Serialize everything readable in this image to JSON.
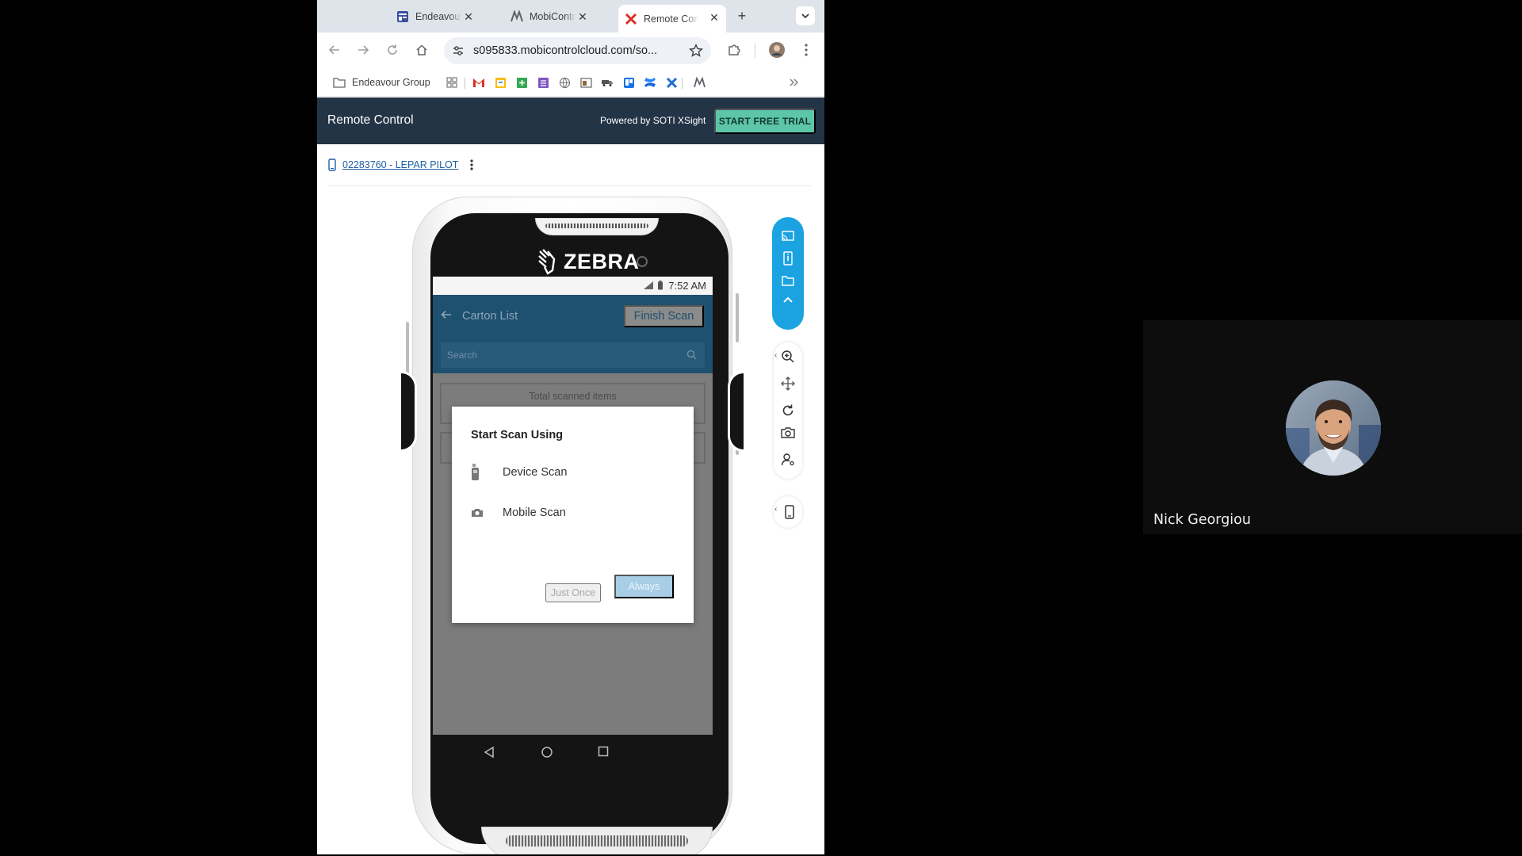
{
  "browser": {
    "tabs": [
      {
        "title": "Endeavour Gr",
        "favicon": "forms-icon",
        "color": "#3c4e9f"
      },
      {
        "title": "MobiControl",
        "favicon": "mobicontrol-icon",
        "color": "#5f6368"
      },
      {
        "title": "Remote Contr",
        "favicon": "soti-x-icon",
        "color": "#d93025"
      }
    ],
    "address": "s095833.mobicontrolcloud.com/so...",
    "bookmark_folder": "Endeavour Group"
  },
  "page": {
    "header_title": "Remote Control",
    "powered_by": "Powered by SOTI XSight",
    "trial_button": "START FREE TRIAL",
    "device_link": "02283760 - LEPAR PILOT"
  },
  "device": {
    "brand": "ZEBRA",
    "status_time": "7:52 AM",
    "app": {
      "title": "Carton List",
      "finish_button": "Finish Scan",
      "search_placeholder": "Search",
      "total_label": "Total scanned items"
    },
    "dialog": {
      "title": "Start Scan Using",
      "options": [
        {
          "label": "Device Scan",
          "icon": "barcode-scanner-icon"
        },
        {
          "label": "Mobile Scan",
          "icon": "camera-icon"
        }
      ],
      "just_once": "Just Once",
      "always": "Always"
    }
  },
  "colors": {
    "header_bg": "#243447",
    "trial_btn": "#5dc5a9",
    "toolbar_pill": "#1aa3e0",
    "app_bar": "#1e5070"
  },
  "participant": {
    "name": "Nick Georgiou"
  }
}
